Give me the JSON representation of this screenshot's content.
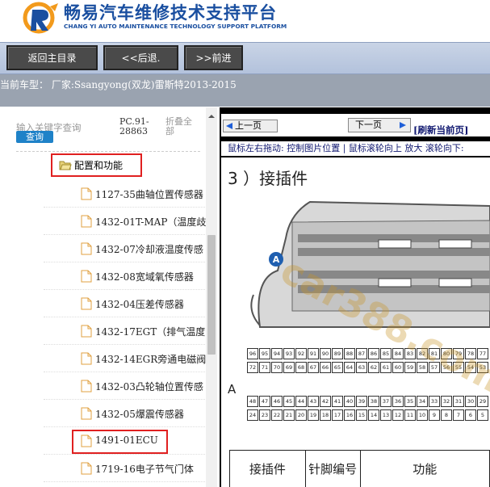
{
  "header": {
    "title": "畅易汽车维修技术支持平台",
    "subtitle": "CHANG YI AUTO MAINTENANCE TECHNOLOGY SUPPORT PLATFORM",
    "logo_icon": "cy-logo-icon"
  },
  "nav": {
    "home_label": "返回主目录",
    "back_label": "<<后退.",
    "forward_label": ">>前进"
  },
  "vehicle": {
    "text": "当前车型： 厂家:Ssangyong(双龙)雷斯特2013-2015"
  },
  "search": {
    "placeholder": "输入关键字查询",
    "button_label": "查询",
    "code": "PC.91-28863",
    "collapse_label": "折叠全部"
  },
  "tree": {
    "folder_label": "配置和功能",
    "items": [
      {
        "label": "1127-35曲轴位置传感器"
      },
      {
        "label": "1432-01T-MAP（温度歧"
      },
      {
        "label": "1432-07冷却液温度传感"
      },
      {
        "label": "1432-08宽域氧传感器"
      },
      {
        "label": "1432-04压差传感器"
      },
      {
        "label": "1432-17EGT（排气温度"
      },
      {
        "label": "1432-14EGR旁通电磁阀"
      },
      {
        "label": "1432-03凸轮轴位置传感"
      },
      {
        "label": "1432-05爆震传感器"
      },
      {
        "label": "1491-01ECU"
      },
      {
        "label": "1719-16电子节气门体"
      }
    ]
  },
  "doc": {
    "prev_label": "上一页",
    "next_label": "下一页",
    "refresh_label": "[刷新当前页]",
    "hint": "鼠标左右拖动: 控制图片位置 | 鼠标滚轮向上 放大  滚轮向下:",
    "heading": "3 ）接插件",
    "connector_marker": "A",
    "row_letter": "A",
    "watermark": "car388.com",
    "pin_rows": [
      [
        "96",
        "95",
        "94",
        "93",
        "92",
        "91",
        "90",
        "89",
        "88",
        "87",
        "86",
        "85",
        "84",
        "83",
        "82",
        "81",
        "80",
        "79",
        "78",
        "77"
      ],
      [
        "72",
        "71",
        "70",
        "69",
        "68",
        "67",
        "66",
        "65",
        "64",
        "63",
        "62",
        "61",
        "60",
        "59",
        "58",
        "57",
        "56",
        "55",
        "54",
        "53"
      ],
      [
        "48",
        "47",
        "46",
        "45",
        "44",
        "43",
        "42",
        "41",
        "40",
        "39",
        "38",
        "37",
        "36",
        "35",
        "34",
        "33",
        "32",
        "31",
        "30",
        "29"
      ],
      [
        "24",
        "23",
        "22",
        "21",
        "20",
        "19",
        "18",
        "17",
        "16",
        "15",
        "14",
        "13",
        "12",
        "11",
        "10",
        "9",
        "8",
        "7",
        "6",
        "5"
      ]
    ],
    "table_headers": [
      "接插件",
      "针脚编号",
      "功能"
    ]
  },
  "colors": {
    "brand_blue": "#1a4fa0",
    "highlight_red": "#e02020",
    "search_button": "#1f82c8"
  }
}
